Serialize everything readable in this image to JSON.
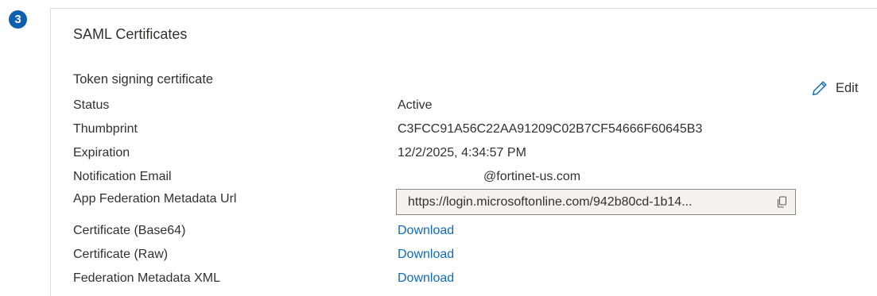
{
  "step": {
    "number": "3"
  },
  "card": {
    "title": "SAML Certificates",
    "section_title": "Token signing certificate",
    "edit_label": "Edit",
    "edit_icon": "pencil-icon",
    "copy_icon": "copy-icon",
    "accent_color": "#0f6cbd",
    "badge_color": "#0f5fb0"
  },
  "rows": {
    "status": {
      "label": "Status",
      "value": "Active"
    },
    "thumbprint": {
      "label": "Thumbprint",
      "value": "C3FCC91A56C22AA91209C02B7CF54666F60645B3"
    },
    "expiration": {
      "label": "Expiration",
      "value": "12/2/2025, 4:34:57 PM"
    },
    "notification_email": {
      "label": "Notification Email",
      "value": "@fortinet-us.com"
    },
    "app_federation_metadata_url": {
      "label": "App Federation Metadata Url",
      "value": "https://login.microsoftonline.com/942b80cd-1b14..."
    },
    "certificate_base64": {
      "label": "Certificate (Base64)",
      "value": "Download"
    },
    "certificate_raw": {
      "label": "Certificate (Raw)",
      "value": "Download"
    },
    "federation_metadata_xml": {
      "label": "Federation Metadata XML",
      "value": "Download"
    }
  }
}
